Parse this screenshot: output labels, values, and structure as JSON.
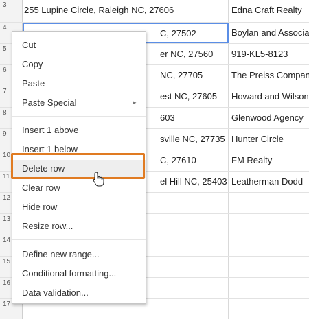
{
  "rows": [
    {
      "num": "3",
      "a": "255 Lupine Circle, Raleigh NC, 27606",
      "b": "Edna Craft Realty"
    },
    {
      "num": "4",
      "a": "C, 27502",
      "b": "Boylan and Associa"
    },
    {
      "num": "5",
      "a": "er NC, 27560",
      "b": "919-KL5-8123"
    },
    {
      "num": "6",
      "a": "NC, 27705",
      "b": "The Preiss Compan"
    },
    {
      "num": "7",
      "a": "est NC, 27605",
      "b": "Howard and Wilson"
    },
    {
      "num": "8",
      "a": "603",
      "b": "Glenwood Agency"
    },
    {
      "num": "9",
      "a": "sville NC, 27735",
      "b": "Hunter Circle"
    },
    {
      "num": "10",
      "a": "C, 27610",
      "b": "FM Realty"
    },
    {
      "num": "11",
      "a": "el Hill NC, 25403",
      "b": "Leatherman Dodd"
    },
    {
      "num": "12",
      "a": "",
      "b": ""
    },
    {
      "num": "13",
      "a": "",
      "b": ""
    },
    {
      "num": "14",
      "a": "",
      "b": ""
    },
    {
      "num": "15",
      "a": "",
      "b": ""
    },
    {
      "num": "16",
      "a": "",
      "b": ""
    },
    {
      "num": "17",
      "a": "",
      "b": ""
    }
  ],
  "menu": {
    "cut": "Cut",
    "copy": "Copy",
    "paste": "Paste",
    "paste_special": "Paste Special",
    "paste_special_arrow": "►",
    "insert_above": "Insert 1 above",
    "insert_below": "Insert 1 below",
    "delete_row": "Delete row",
    "clear_row": "Clear row",
    "hide_row": "Hide row",
    "resize_row": "Resize row...",
    "define_range": "Define new range...",
    "conditional_formatting": "Conditional formatting...",
    "data_validation": "Data validation..."
  },
  "colors": {
    "highlight_outline": "#e07b22",
    "selection_border": "#5b8ee6"
  }
}
